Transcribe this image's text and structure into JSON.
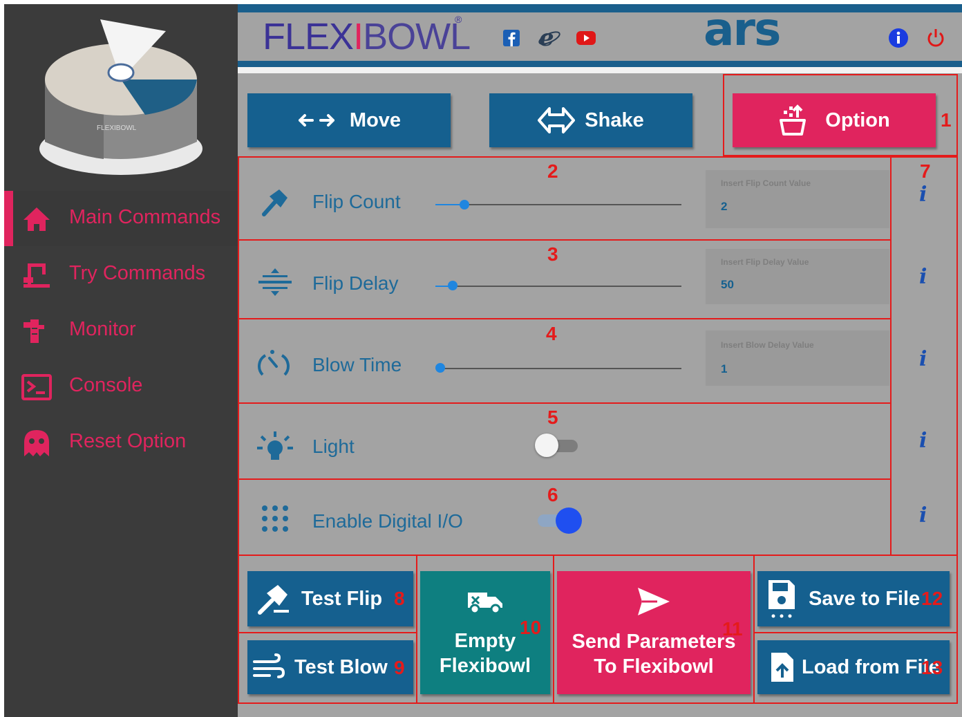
{
  "header": {
    "brand_flex": "FLEX",
    "brand_i": "I",
    "brand_bowl": "BOWL",
    "brand_reg": "®",
    "company": "ars",
    "social_icons": [
      "facebook-icon",
      "internet-explorer-icon",
      "youtube-icon"
    ],
    "right_icons": [
      "info-icon",
      "power-icon"
    ]
  },
  "sidebar": {
    "items": [
      {
        "label": "Main Commands",
        "icon": "home-icon",
        "active": true
      },
      {
        "label": "Try Commands",
        "icon": "robot-arm-icon",
        "active": false
      },
      {
        "label": "Monitor",
        "icon": "monitor-icon",
        "active": false
      },
      {
        "label": "Console",
        "icon": "console-icon",
        "active": false
      },
      {
        "label": "Reset Option",
        "icon": "ghost-icon",
        "active": false
      }
    ]
  },
  "top_buttons": {
    "move": "Move",
    "shake": "Shake",
    "option": "Option"
  },
  "params": [
    {
      "label": "Flip Count",
      "placeholder": "Insert Flip Count Value",
      "value": "2",
      "slider": 0.12
    },
    {
      "label": "Flip Delay",
      "placeholder": "Insert Flip Delay Value",
      "value": "50",
      "slider": 0.07
    },
    {
      "label": "Blow Time",
      "placeholder": "Insert Blow Delay Value",
      "value": "1",
      "slider": 0.02
    }
  ],
  "toggles": [
    {
      "label": "Light",
      "on": false
    },
    {
      "label": "Enable Digital I/O",
      "on": true
    }
  ],
  "info_label": "i",
  "bottom_buttons": {
    "test_flip": "Test Flip",
    "test_blow": "Test Blow",
    "empty_line1": "Empty",
    "empty_line2": "Flexibowl",
    "send_line1": "Send Parameters",
    "send_line2": "To Flexibowl",
    "save": "Save to File",
    "load": "Load from File"
  },
  "annotations": [
    "1",
    "2",
    "3",
    "4",
    "5",
    "6",
    "7",
    "8",
    "9",
    "10",
    "11",
    "12",
    "13"
  ],
  "colors": {
    "accent_pink": "#e0245e",
    "primary_blue": "#15608f",
    "teal": "#0e7f80",
    "annotation_red": "#e41b1b",
    "sidebar_bg": "#3b3b3b",
    "main_bg": "#a3a3a3"
  }
}
